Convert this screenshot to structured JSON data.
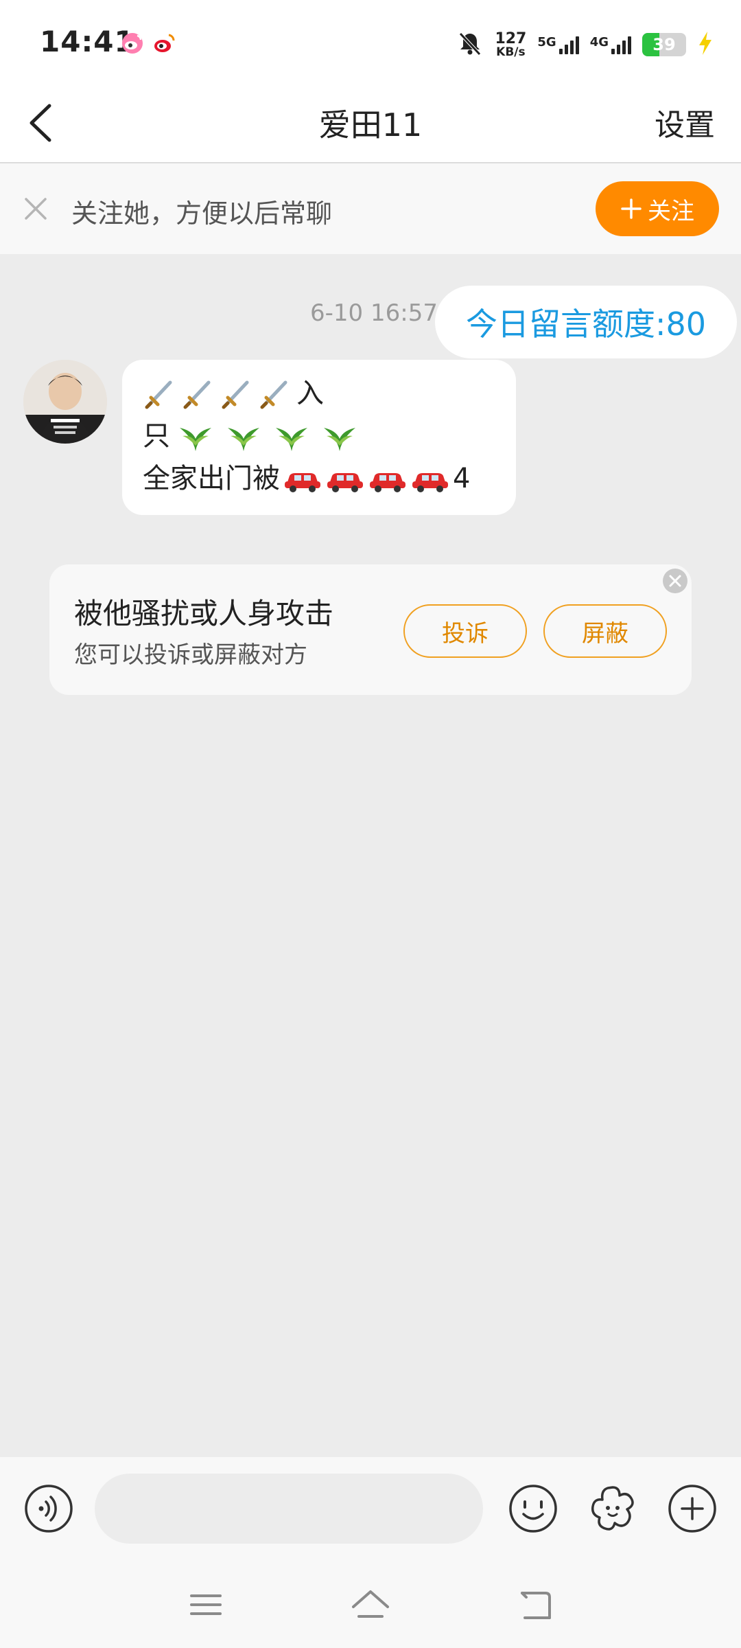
{
  "status_bar": {
    "time": "14:41",
    "net_speed_value": "127",
    "net_speed_unit": "KB/s",
    "net_5g": "5G",
    "net_4g": "4G",
    "battery": "39",
    "battery_level": 0.39
  },
  "header": {
    "title": "爱田11",
    "settings_label": "设置"
  },
  "follow_bar": {
    "text": "关注她，方便以后常聊",
    "button_label": "关注"
  },
  "chat": {
    "timestamp": "6-10 16:57",
    "quota_text": "今日留言额度:80",
    "message": {
      "line1_suffix": "入",
      "line2_prefix": "只",
      "line3_prefix": "全家出门被",
      "line3_suffix": "4"
    }
  },
  "harassment_card": {
    "title": "被他骚扰或人身攻击",
    "subtitle": "您可以投诉或屏蔽对方",
    "complain_label": "投诉",
    "block_label": "屏蔽"
  },
  "input_bar": {
    "placeholder": ""
  },
  "colors": {
    "accent_orange": "#ff8a00",
    "quota_blue": "#1a9ae0",
    "chat_background": "#ececec"
  }
}
